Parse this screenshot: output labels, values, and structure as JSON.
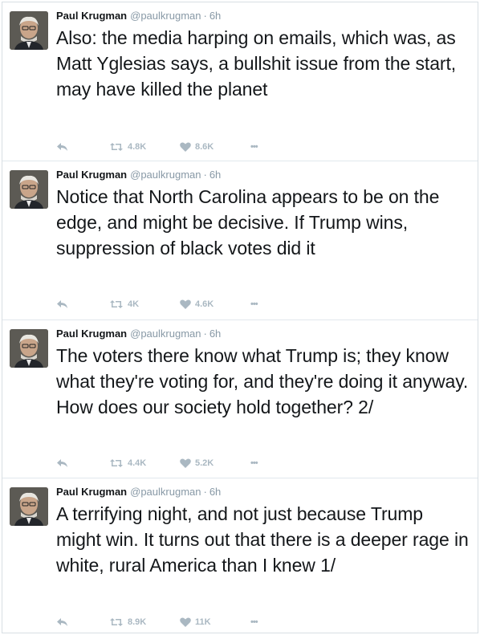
{
  "tweets": [
    {
      "name": "Paul Krugman",
      "handle": "@paulkrugman",
      "separator": "·",
      "time": "6h",
      "text": "Also: the media harping on emails, which was, as Matt Yglesias says, a bullshit issue from the start, may have killed the planet",
      "retweets": "4.8K",
      "likes": "8.6K",
      "more": "•••"
    },
    {
      "name": "Paul Krugman",
      "handle": "@paulkrugman",
      "separator": "·",
      "time": "6h",
      "text": "Notice that North Carolina appears to be on the edge, and might be decisive. If Trump wins, suppression of black votes did it",
      "retweets": "4K",
      "likes": "4.6K",
      "more": "•••"
    },
    {
      "name": "Paul Krugman",
      "handle": "@paulkrugman",
      "separator": "·",
      "time": "6h",
      "text": "The voters there know what Trump is; they know what they're voting for, and they're doing it anyway. How does our society hold together? 2/",
      "retweets": "4.4K",
      "likes": "5.2K",
      "more": "•••"
    },
    {
      "name": "Paul Krugman",
      "handle": "@paulkrugman",
      "separator": "·",
      "time": "6h",
      "text": "A terrifying night, and not just because Trump might win. It turns out that there is a deeper rage in white, rural America than I knew 1/",
      "retweets": "8.9K",
      "likes": "11K",
      "more": "•••"
    }
  ],
  "colors": {
    "text": "#14171a",
    "muted": "#8899a6",
    "action": "#aab8c2",
    "border": "#e1e8ed"
  }
}
